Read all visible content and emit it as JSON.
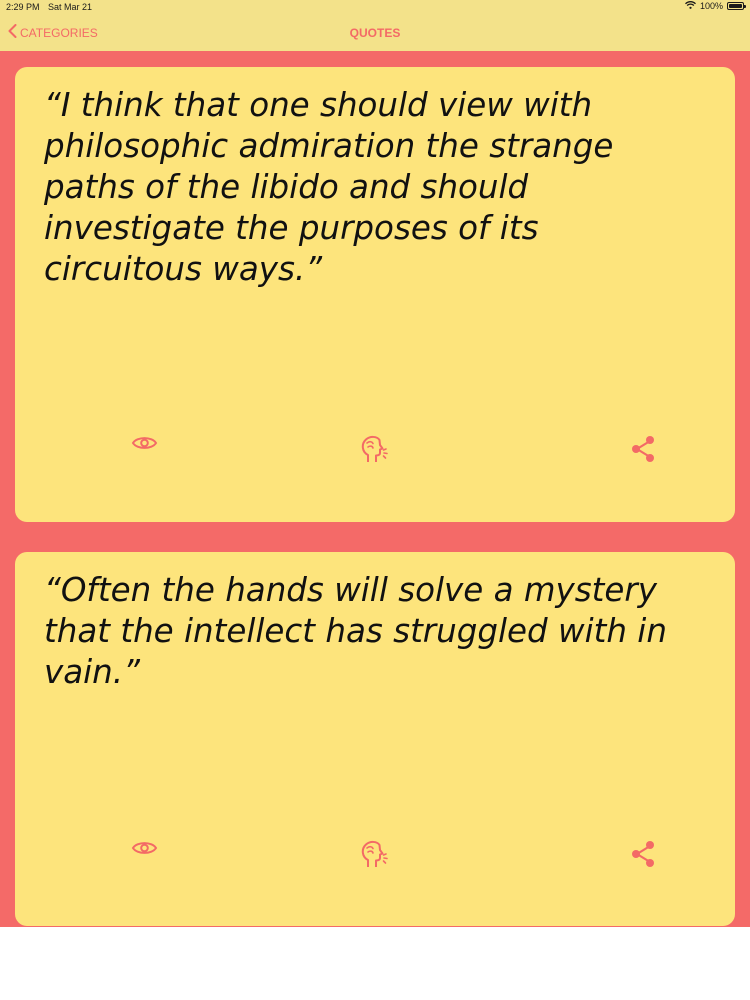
{
  "status_bar": {
    "time": "2:29 PM",
    "date": "Sat Mar 21",
    "battery": "100%",
    "battery_level": 1.0
  },
  "nav": {
    "back_label": "CATEGORIES",
    "title": "QUOTES"
  },
  "colors": {
    "accent": "#f36a66",
    "background": "#f46a68",
    "card": "#fde47c",
    "bar": "#f3e28a"
  },
  "quotes": [
    {
      "text": "“I think that one should view with philosophic admiration the strange paths of the libido and should investigate the purposes of its circuitous ways.”",
      "actions": [
        "eye-icon",
        "speaking-head-icon",
        "share-icon"
      ]
    },
    {
      "text": "“Often the hands will solve a mystery that the intellect has struggled with in vain.”",
      "actions": [
        "eye-icon",
        "speaking-head-icon",
        "share-icon"
      ]
    }
  ]
}
